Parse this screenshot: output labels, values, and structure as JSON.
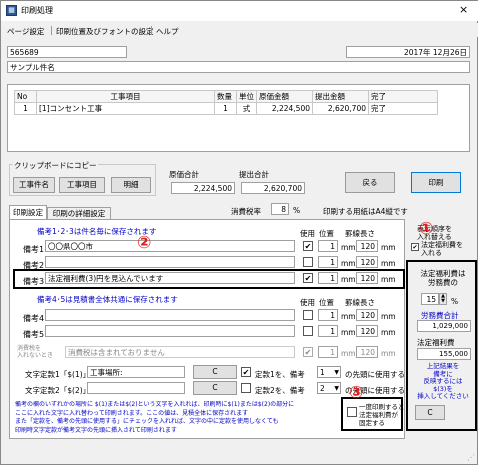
{
  "window": {
    "title": "印刷処理",
    "close": "×"
  },
  "menu": [
    "ページ設定",
    "印刷位置及びフォントの設定",
    "ヘルプ"
  ],
  "header": {
    "code": "565689",
    "date": "2017年 12月26日",
    "name": "サンプル件名"
  },
  "table": {
    "headers": [
      "No",
      "工事項目",
      "数量",
      "単位",
      "原価金額",
      "提出金額",
      "完了"
    ],
    "rows": [
      [
        "1",
        "[1]コンセント工事",
        "1",
        "式",
        "2,224,500",
        "2,620,700",
        "完了"
      ]
    ]
  },
  "clipboard": {
    "title": "クリップボードにコピー",
    "buttons": [
      "工事件名",
      "工事項目",
      "明細"
    ]
  },
  "totals": {
    "cost_label": "原価合計",
    "cost": "2,224,500",
    "submit_label": "提出合計",
    "submit": "2,620,700"
  },
  "actions": {
    "back": "戻る",
    "print": "印刷"
  },
  "tabs": [
    "印刷設定",
    "印刷の詳細設定"
  ],
  "tax": {
    "label": "消費税率",
    "value": "8",
    "unit": "%",
    "paper_note": "印刷する用紙はA4縦です"
  },
  "remarks": {
    "heading1": "備考1･2･3は件名毎に保存されます",
    "heading2": "備考4･5は見積書全体共通に保存されます",
    "col_use": "使用",
    "col_pos": "位置",
    "col_indent": "罫線長さ",
    "unit_mm": "mm",
    "rows": [
      {
        "label": "備考1",
        "value": "〇〇県〇〇市",
        "checked": true,
        "pos": "1",
        "len": "120"
      },
      {
        "label": "備考2",
        "value": "",
        "checked": false,
        "pos": "1",
        "len": "120"
      },
      {
        "label": "備考3",
        "value": "法定福利費(3)円を見込んでいます",
        "checked": true,
        "pos": "1",
        "len": "120"
      },
      {
        "label": "備考4",
        "value": "",
        "checked": false,
        "pos": "1",
        "len": "120"
      },
      {
        "label": "備考5",
        "value": "",
        "checked": false,
        "pos": "1",
        "len": "120"
      }
    ],
    "tax_label": "消費税を\n入れないとき",
    "tax_value": "消費税は含まれておりません",
    "tax_pos": "1",
    "tax_len": "120"
  },
  "fixed": {
    "label1": "文字定款1「$(1)」",
    "value1": "工事場所:",
    "label2": "文字定款2「$(2)」",
    "value2": "",
    "c": "C",
    "check1": "定款1を、備考",
    "sel1": "1",
    "after1": "の先頭に使用する",
    "check2": "定款2を、備考",
    "sel2": "2",
    "after2": "の先頭に使用する"
  },
  "note": "備考の欄のいずれかの場所に $(1)または$(2)という文字を入れれば、印刷時に$(1)または$(2)の部分に\nここに入れた文字に入れ替わって印刷されます。ここの値は、見積全体に保存されます\nまた「定款を、備考の先頭に使用する」にチェックを入れれば、文字の中に定款を使用しなくても\n印刷時文字定款が備考文字の先頭に挿入されて印刷されます",
  "right_panel": {
    "top_lines": [
      "表示順序を",
      "入れ替える",
      "法定福利費を",
      "入れる"
    ],
    "title": "法定福利費は\n労務費の",
    "pct": "15",
    "pct_unit": "%",
    "labor_label": "労務費合計",
    "labor": "1,029,000",
    "welfare_label": "法定福利費",
    "welfare": "155,000",
    "info": "上記結果を\n備考に\n反映するには\n$(3)を\n挿入してください",
    "c": "C",
    "once": "一度印刷すると\n法定福利費が\n固定する"
  },
  "markers": [
    "①",
    "②",
    "③"
  ],
  "colors": {
    "red": "#e02020",
    "blue": "#0000c8",
    "frame": "#000000"
  }
}
